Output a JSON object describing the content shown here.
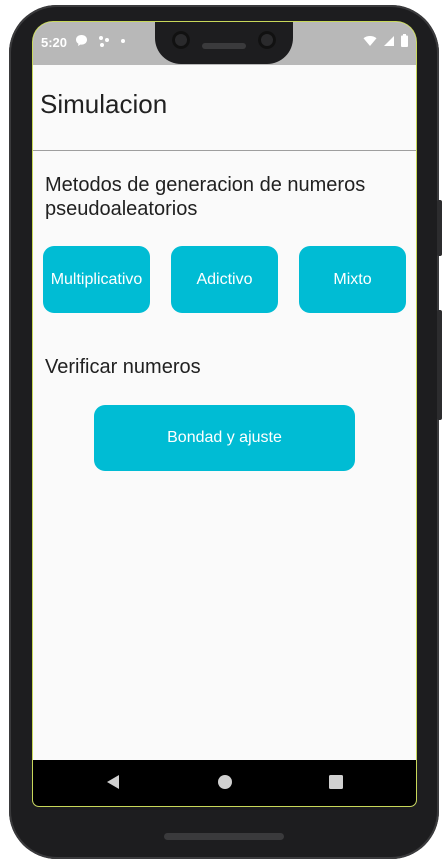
{
  "status_bar": {
    "time": "5:20",
    "left_icons": [
      "chat-bubble-icon",
      "network-dots-icon",
      "dot-icon"
    ],
    "right_icons": [
      "wifi-icon",
      "signal-icon",
      "battery-icon"
    ]
  },
  "app_bar": {
    "title": "Simulacion"
  },
  "generation_section": {
    "title": "Metodos de generacion de numeros pseudoaleatorios",
    "buttons": [
      {
        "label": "Multiplicativo"
      },
      {
        "label": "Adictivo"
      },
      {
        "label": "Mixto"
      }
    ]
  },
  "verify_section": {
    "title": "Verificar numeros",
    "button_label": "Bondad y ajuste"
  },
  "nav_bar": {
    "items": [
      "back-icon",
      "home-icon",
      "recents-icon"
    ]
  },
  "colors": {
    "accent": "#00bcd4",
    "status_bar": "#b8b8b8",
    "background": "#fafafa"
  }
}
